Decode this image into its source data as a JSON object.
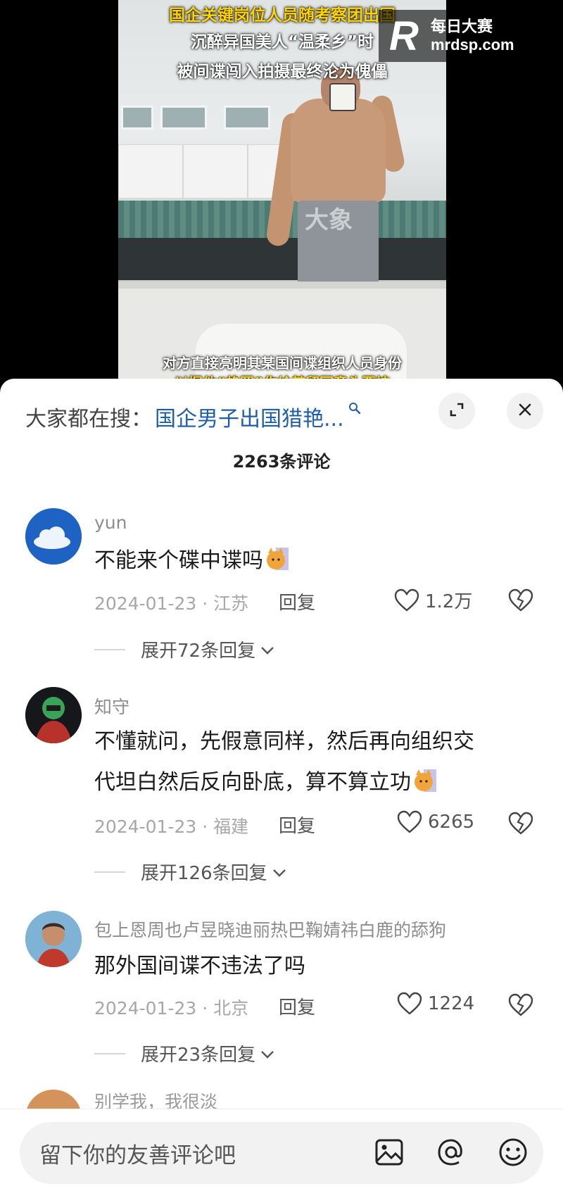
{
  "video": {
    "caption_line1": "国企关键岗位人员随考察团出国",
    "caption_line2": "沉醉异国美人“温柔乡”时",
    "caption_line3": "被间谍闯入拍摄最终沦为傀儡",
    "caption_bottom": "对方直接亮明其某国间谍组织人员身份",
    "caption_bottom2": "以握他“艳照”作给其留回意头要挟",
    "watermark_center": "大象",
    "logo_letter": "R",
    "logo_cn": "每日大赛",
    "logo_en": "mrdsp.com"
  },
  "sheet": {
    "search_prefix": "大家都在搜：",
    "search_term": "国企男子出国猎艳...",
    "comment_count": "2263条评论"
  },
  "comments": [
    {
      "username": "yun",
      "text": "不能来个碟中谍吗",
      "date_location": "2024-01-23 · 江苏",
      "reply": "回复",
      "likes": "1.2万",
      "expand": "展开72条回复"
    },
    {
      "username": "知守",
      "text_line1": "不懂就问，先假意同样，然后再向组织交",
      "text_line2": "代坦白然后反向卧底，算不算立功",
      "date_location": "2024-01-23 · 福建",
      "reply": "回复",
      "likes": "6265",
      "expand": "展开126条回复"
    },
    {
      "username": "包上恩周也卢昱晓迪丽热巴鞠婧祎白鹿的舔狗",
      "text": "那外国间谍不违法了吗",
      "date_location": "2024-01-23 · 北京",
      "reply": "回复",
      "likes": "1224",
      "expand": "展开23条回复"
    }
  ],
  "partial_comment_username": "别学我，我很淡",
  "input": {
    "placeholder": "留下你的友善评论吧"
  },
  "colors": {
    "search_term": "#1f5ea8",
    "caption_yellow": "#ffd400",
    "meta_gray": "#a7a7a7"
  }
}
